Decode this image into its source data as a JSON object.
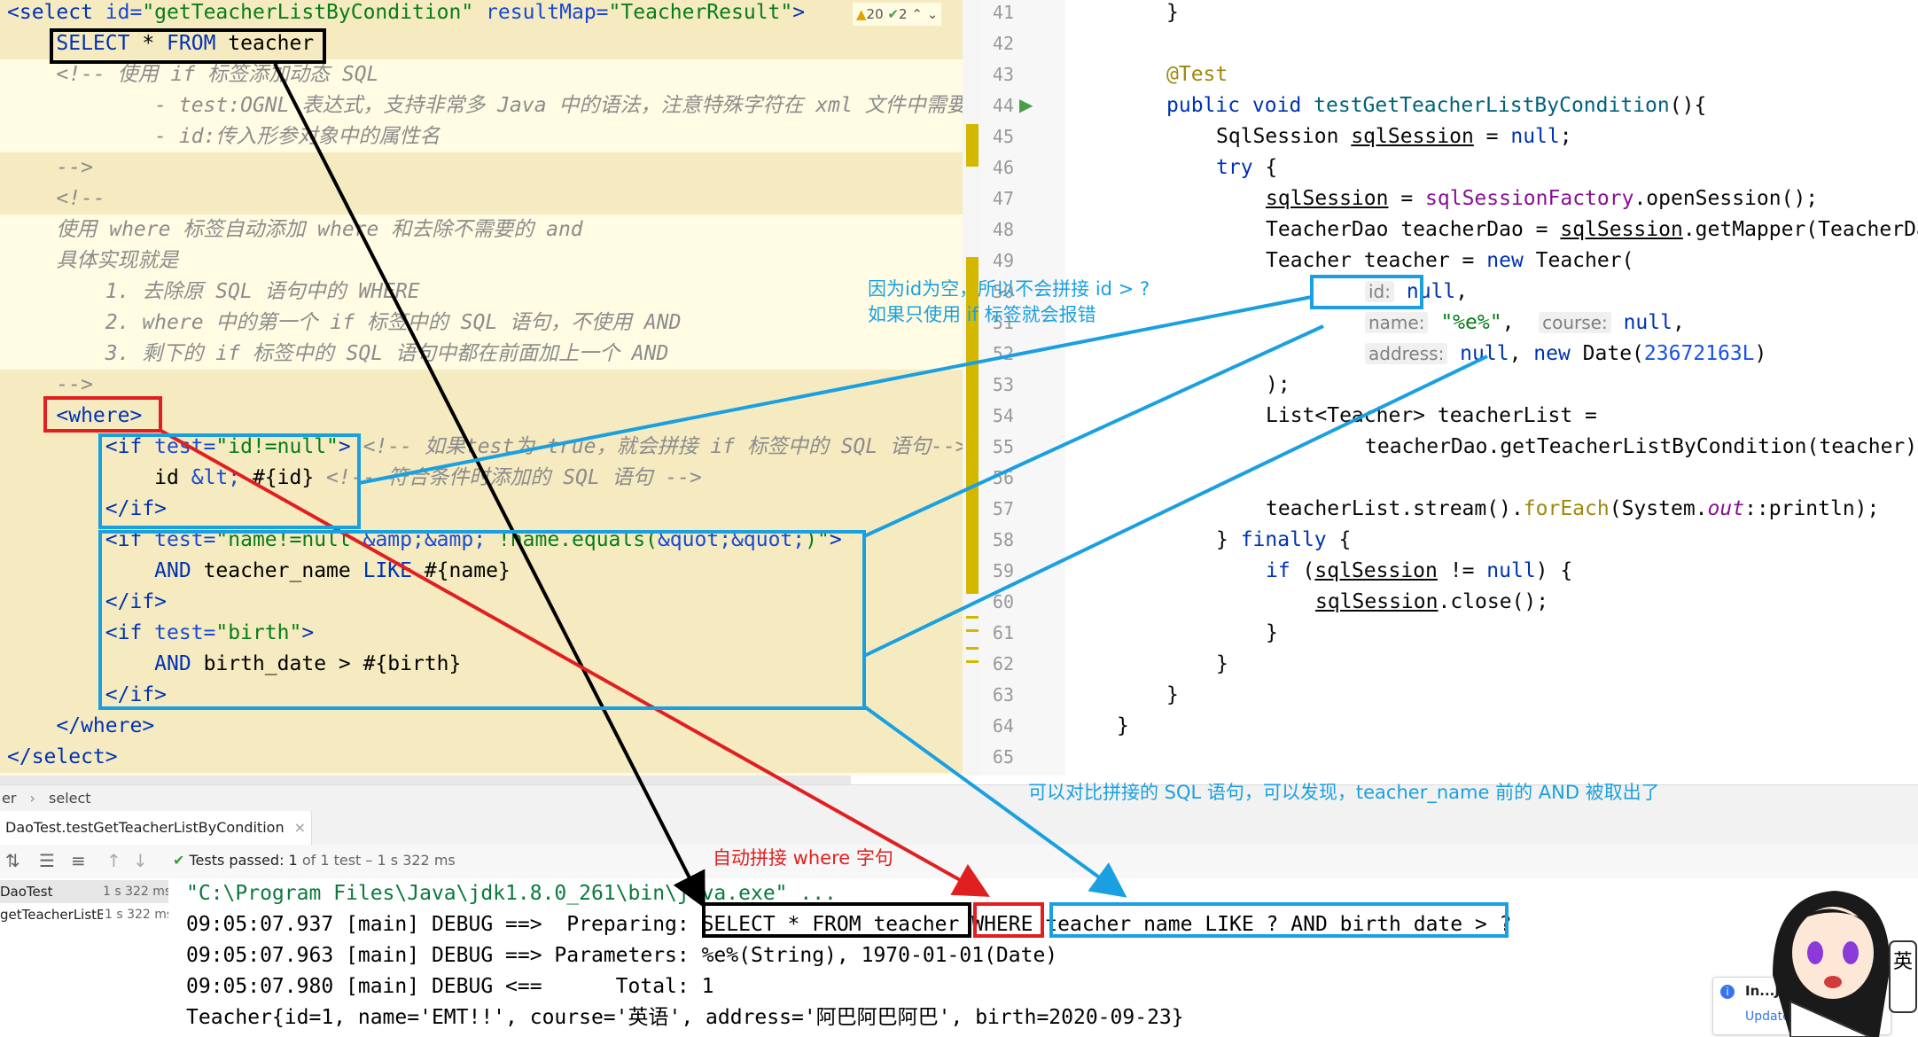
{
  "inspection": {
    "warnings": "20",
    "checks": "2"
  },
  "xml_lines": [
    {
      "n": 1,
      "tokens": [
        [
          "tag",
          "<select "
        ],
        [
          "attr",
          "id="
        ],
        [
          "str",
          "\"getTeacherListByCondition\""
        ],
        [
          "attr",
          " resultMap="
        ],
        [
          "str",
          "\"TeacherResult\""
        ],
        [
          "tag",
          ">"
        ]
      ]
    },
    {
      "n": 2,
      "tokens": [
        [
          "plain",
          "    "
        ],
        [
          "kw",
          "SELECT"
        ],
        [
          "plain",
          " * "
        ],
        [
          "kw",
          "FROM"
        ],
        [
          "plain",
          " teacher"
        ]
      ]
    },
    {
      "n": 3,
      "tokens": [
        [
          "cmt",
          "    <!-- 使用 if 标签添加动态 SQL"
        ]
      ]
    },
    {
      "n": 4,
      "tokens": [
        [
          "cmt",
          "            - test:OGNL 表达式，支持非常多 Java 中的语法，注意特殊字符在 xml 文件中需要使用"
        ]
      ]
    },
    {
      "n": 5,
      "tokens": [
        [
          "cmt",
          "            - id:传入形参对象中的属性名"
        ]
      ]
    },
    {
      "n": 6,
      "tokens": [
        [
          "cmt",
          "    -->"
        ]
      ]
    },
    {
      "n": 7,
      "tokens": [
        [
          "cmt",
          "    <!--"
        ]
      ]
    },
    {
      "n": 8,
      "tokens": [
        [
          "cmt",
          "    使用 where 标签自动添加 where 和去除不需要的 and"
        ]
      ]
    },
    {
      "n": 9,
      "tokens": [
        [
          "cmt",
          "    具体实现就是"
        ]
      ]
    },
    {
      "n": 10,
      "tokens": [
        [
          "cmt",
          "        1. 去除原 SQL 语句中的 WHERE"
        ]
      ]
    },
    {
      "n": 11,
      "tokens": [
        [
          "cmt",
          "        2. where 中的第一个 if 标签中的 SQL 语句，不使用 AND"
        ]
      ]
    },
    {
      "n": 12,
      "tokens": [
        [
          "cmt",
          "        3. 剩下的 if 标签中的 SQL 语句中都在前面加上一个 AND"
        ]
      ]
    },
    {
      "n": 13,
      "tokens": [
        [
          "cmt",
          "    -->"
        ]
      ]
    },
    {
      "n": 14,
      "tokens": [
        [
          "plain",
          "    "
        ],
        [
          "tag",
          "<where>"
        ]
      ]
    },
    {
      "n": 15,
      "tokens": [
        [
          "plain",
          "        "
        ],
        [
          "tag",
          "<if "
        ],
        [
          "attr",
          "test="
        ],
        [
          "str",
          "\"id!=null\""
        ],
        [
          "tag",
          ">"
        ],
        [
          "cmt",
          " <!-- 如果test为 true，就会拼接 if 标签中的 SQL 语句-->"
        ]
      ]
    },
    {
      "n": 16,
      "tokens": [
        [
          "plain",
          "            id "
        ],
        [
          "ent",
          "&lt;"
        ],
        [
          "plain",
          " #{id} "
        ],
        [
          "cmt",
          "<!-- 符合条件时添加的 SQL 语句 -->"
        ]
      ]
    },
    {
      "n": 17,
      "tokens": [
        [
          "plain",
          "        "
        ],
        [
          "tag",
          "</if>"
        ]
      ]
    },
    {
      "n": 18,
      "tokens": [
        [
          "plain",
          "        "
        ],
        [
          "tag",
          "<if "
        ],
        [
          "attr",
          "test="
        ],
        [
          "str",
          "\"name!=null "
        ],
        [
          "ent",
          "&amp;&amp;"
        ],
        [
          "str",
          " !name.equals("
        ],
        [
          "ent",
          "&quot;&quot;"
        ],
        [
          "str",
          ")\""
        ],
        [
          "tag",
          ">"
        ]
      ]
    },
    {
      "n": 19,
      "tokens": [
        [
          "plain",
          "            "
        ],
        [
          "kw",
          "AND"
        ],
        [
          "plain",
          " teacher_name "
        ],
        [
          "kw",
          "LIKE"
        ],
        [
          "plain",
          " #{name}"
        ]
      ]
    },
    {
      "n": 20,
      "tokens": [
        [
          "plain",
          "        "
        ],
        [
          "tag",
          "</if>"
        ]
      ]
    },
    {
      "n": 21,
      "tokens": [
        [
          "plain",
          "        "
        ],
        [
          "tag",
          "<if "
        ],
        [
          "attr",
          "test="
        ],
        [
          "str",
          "\"birth\""
        ],
        [
          "tag",
          ">"
        ]
      ]
    },
    {
      "n": 22,
      "tokens": [
        [
          "plain",
          "            "
        ],
        [
          "kw",
          "AND"
        ],
        [
          "plain",
          " birth_date > #{birth}"
        ]
      ]
    },
    {
      "n": 23,
      "tokens": [
        [
          "plain",
          "        "
        ],
        [
          "tag",
          "</if>"
        ]
      ]
    },
    {
      "n": 24,
      "tokens": [
        [
          "plain",
          "    "
        ],
        [
          "tag",
          "</where>"
        ]
      ]
    },
    {
      "n": 25,
      "tokens": [
        [
          "tag",
          "</select>"
        ]
      ]
    }
  ],
  "java_line_numbers": [
    "41",
    "42",
    "43",
    "44",
    "45",
    "46",
    "47",
    "48",
    "49",
    "50",
    "51",
    "52",
    "53",
    "54",
    "55",
    "56",
    "57",
    "58",
    "59",
    "60",
    "61",
    "62",
    "63",
    "64",
    "65"
  ],
  "java_lines": [
    {
      "indent": 1,
      "tokens": [
        [
          "plain",
          "}"
        ]
      ]
    },
    {
      "indent": 0,
      "tokens": []
    },
    {
      "indent": 1,
      "tokens": [
        [
          "jann",
          "@Test"
        ]
      ]
    },
    {
      "indent": 1,
      "tokens": [
        [
          "jkw",
          "public void "
        ],
        [
          "jfn",
          "testGetTeacherListByCondition"
        ],
        [
          "plain",
          "(){"
        ]
      ]
    },
    {
      "indent": 2,
      "tokens": [
        [
          "plain",
          "SqlSession "
        ],
        [
          "ul",
          "sqlSession"
        ],
        [
          "plain",
          " = "
        ],
        [
          "jkw",
          "null"
        ],
        [
          "plain",
          ";"
        ]
      ]
    },
    {
      "indent": 2,
      "tokens": [
        [
          "jkw",
          "try"
        ],
        [
          "plain",
          " {"
        ]
      ]
    },
    {
      "indent": 3,
      "tokens": [
        [
          "ul",
          "sqlSession"
        ],
        [
          "plain",
          " = "
        ],
        [
          "jfld",
          "sqlSessionFactory"
        ],
        [
          "plain",
          ".openSession();"
        ]
      ]
    },
    {
      "indent": 3,
      "tokens": [
        [
          "plain",
          "TeacherDao teacherDao = "
        ],
        [
          "ul",
          "sqlSession"
        ],
        [
          "plain",
          ".getMapper(TeacherDao.c"
        ]
      ]
    },
    {
      "indent": 3,
      "tokens": [
        [
          "plain",
          "Teacher teacher = "
        ],
        [
          "jkw",
          "new"
        ],
        [
          "plain",
          " Teacher("
        ]
      ]
    },
    {
      "indent": 5,
      "tokens": [
        [
          "hint",
          "id:"
        ],
        [
          "plain",
          " "
        ],
        [
          "jkw",
          "null"
        ],
        [
          "plain",
          ","
        ]
      ]
    },
    {
      "indent": 5,
      "tokens": [
        [
          "hint",
          "name:"
        ],
        [
          "plain",
          " "
        ],
        [
          "jstr",
          "\"%e%\""
        ],
        [
          "plain",
          ",  "
        ],
        [
          "hint",
          "course:"
        ],
        [
          "plain",
          " "
        ],
        [
          "jkw",
          "null"
        ],
        [
          "plain",
          ","
        ]
      ]
    },
    {
      "indent": 5,
      "tokens": [
        [
          "hint",
          "address:"
        ],
        [
          "plain",
          " "
        ],
        [
          "jkw",
          "null"
        ],
        [
          "plain",
          ", "
        ],
        [
          "jkw",
          "new"
        ],
        [
          "plain",
          " Date("
        ],
        [
          "jnum",
          "23672163L"
        ],
        [
          "plain",
          ")"
        ]
      ]
    },
    {
      "indent": 3,
      "tokens": [
        [
          "plain",
          ");"
        ]
      ]
    },
    {
      "indent": 3,
      "tokens": [
        [
          "plain",
          "List<Teacher> teacherList ="
        ]
      ]
    },
    {
      "indent": 5,
      "tokens": [
        [
          "plain",
          "teacherDao.getTeacherListByCondition(teacher);"
        ]
      ]
    },
    {
      "indent": 0,
      "tokens": []
    },
    {
      "indent": 3,
      "tokens": [
        [
          "plain",
          "teacherList.stream()."
        ],
        [
          "jann",
          "forEach"
        ],
        [
          "plain",
          "(System."
        ],
        [
          "jit",
          "out"
        ],
        [
          "plain",
          "::println);"
        ]
      ]
    },
    {
      "indent": 2,
      "tokens": [
        [
          "plain",
          "} "
        ],
        [
          "jkw",
          "finally"
        ],
        [
          "plain",
          " {"
        ]
      ]
    },
    {
      "indent": 3,
      "tokens": [
        [
          "jkw",
          "if"
        ],
        [
          "plain",
          " ("
        ],
        [
          "ul",
          "sqlSession"
        ],
        [
          "plain",
          " != "
        ],
        [
          "jkw",
          "null"
        ],
        [
          "plain",
          ") {"
        ]
      ]
    },
    {
      "indent": 4,
      "tokens": [
        [
          "ul",
          "sqlSession"
        ],
        [
          "plain",
          ".close();"
        ]
      ]
    },
    {
      "indent": 3,
      "tokens": [
        [
          "plain",
          "}"
        ]
      ]
    },
    {
      "indent": 2,
      "tokens": [
        [
          "plain",
          "}"
        ]
      ]
    },
    {
      "indent": 1,
      "tokens": [
        [
          "plain",
          "}"
        ]
      ]
    },
    {
      "indent": 0,
      "tokens": [
        [
          "plain",
          "}"
        ]
      ]
    },
    {
      "indent": 0,
      "tokens": []
    }
  ],
  "breadcrumb": {
    "items": [
      "er",
      "select"
    ]
  },
  "run_tab": {
    "title": "DaoTest.testGetTeacherListByCondition"
  },
  "test_status": {
    "label": "Tests passed:",
    "count": "1",
    "detail": "of 1 test – 1 s 322 ms"
  },
  "test_tree": [
    {
      "name": "DaoTest",
      "time": "1 s 322 ms"
    },
    {
      "name": "getTeacherListBy",
      "time": "1 s 322 ms"
    }
  ],
  "console_lines": [
    "\"C:\\Program Files\\Java\\jdk1.8.0_261\\bin\\java.exe\" ...",
    "09:05:07.937 [main] DEBUG ==>  Preparing: SELECT * FROM teacher WHERE teacher_name LIKE ? AND birth_date > ?",
    "09:05:07.963 [main] DEBUG ==> Parameters: %e%(String), 1970-01-01(Date)",
    "09:05:07.980 [main] DEBUG <==      Total: 1",
    "Teacher{id=1, name='EMT!!', course='英语', address='阿巴阿巴阿巴', birth=2020-09-23}"
  ],
  "annotations": {
    "id_note_line1": "因为id为空，所以不会拼接 id > ?",
    "id_note_line2": "如果只使用 if 标签就会报错",
    "compare_note": "可以对比拼接的 SQL 语句，可以发现，teacher_name 前的 AND 被取出了",
    "where_note": "自动拼接 where 字句"
  },
  "notification": {
    "title": "In...J",
    "link": "Update..."
  },
  "mascot": {
    "badge_char": "英",
    "colors": {
      "hair": "#1a1a1a",
      "skin": "#fde7d6",
      "eyes": "#8a3ad8"
    }
  },
  "colors": {
    "editor_bg": "#fffce3",
    "highlight": "#f5eac0",
    "box_black": "#000000",
    "box_red": "#e02020",
    "box_blue": "#1aa0e0"
  }
}
